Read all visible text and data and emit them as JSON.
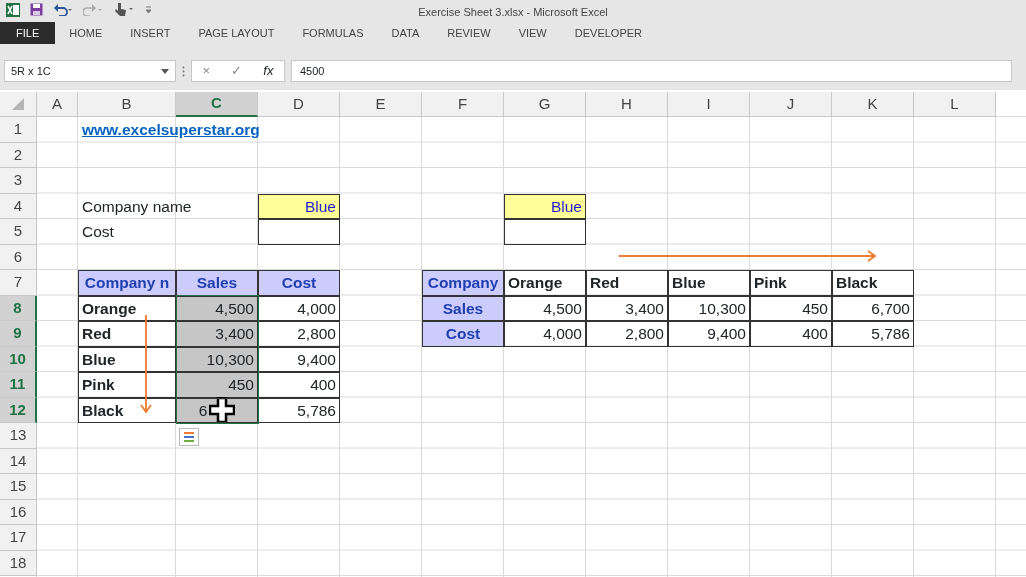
{
  "window": {
    "title": "Exercise Sheet 3.xlsx - Microsoft Excel"
  },
  "ribbon_tabs": [
    {
      "label": "FILE",
      "selected": true
    },
    {
      "label": "HOME",
      "selected": false
    },
    {
      "label": "INSERT",
      "selected": false
    },
    {
      "label": "PAGE LAYOUT",
      "selected": false
    },
    {
      "label": "FORMULAS",
      "selected": false
    },
    {
      "label": "DATA",
      "selected": false
    },
    {
      "label": "REVIEW",
      "selected": false
    },
    {
      "label": "VIEW",
      "selected": false
    },
    {
      "label": "DEVELOPER",
      "selected": false
    }
  ],
  "name_box": {
    "value": "5R x 1C"
  },
  "formula_bar": {
    "cancel": "×",
    "enter": "✓",
    "function": "fx",
    "value": "4500"
  },
  "columns": [
    {
      "letter": "A",
      "selected": false
    },
    {
      "letter": "B",
      "selected": false
    },
    {
      "letter": "C",
      "selected": true
    },
    {
      "letter": "D",
      "selected": false
    },
    {
      "letter": "E",
      "selected": false
    },
    {
      "letter": "F",
      "selected": false
    },
    {
      "letter": "G",
      "selected": false
    },
    {
      "letter": "H",
      "selected": false
    },
    {
      "letter": "I",
      "selected": false
    },
    {
      "letter": "J",
      "selected": false
    },
    {
      "letter": "K",
      "selected": false
    },
    {
      "letter": "L",
      "selected": false
    }
  ],
  "rows": [
    {
      "number": "1",
      "selected": false,
      "cells": {
        "B": {
          "kind": "link",
          "text": "www.excelsuperstar.org"
        }
      }
    },
    {
      "number": "2",
      "selected": false,
      "cells": {}
    },
    {
      "number": "3",
      "selected": false,
      "cells": {}
    },
    {
      "number": "4",
      "selected": false,
      "cells": {
        "B": {
          "kind": "text",
          "text": "Company name"
        },
        "D": {
          "kind": "input",
          "text": "Blue"
        },
        "G": {
          "kind": "input",
          "text": "Blue"
        }
      }
    },
    {
      "number": "5",
      "selected": false,
      "cells": {
        "B": {
          "kind": "text",
          "text": "Cost"
        },
        "D": {
          "kind": "box"
        },
        "G": {
          "kind": "box"
        }
      }
    },
    {
      "number": "6",
      "selected": false,
      "cells": {}
    },
    {
      "number": "7",
      "selected": false,
      "cells": {
        "B": {
          "kind": "header",
          "text": "Company n"
        },
        "C": {
          "kind": "header",
          "text": "Sales"
        },
        "D": {
          "kind": "header",
          "text": "Cost"
        },
        "F": {
          "kind": "header",
          "text": "Company"
        },
        "G": {
          "kind": "label",
          "text": "Orange"
        },
        "H": {
          "kind": "label",
          "text": "Red"
        },
        "I": {
          "kind": "label",
          "text": "Blue"
        },
        "J": {
          "kind": "label",
          "text": "Pink"
        },
        "K": {
          "kind": "label",
          "text": "Black"
        }
      }
    },
    {
      "number": "8",
      "selected": true,
      "cells": {
        "B": {
          "kind": "label",
          "text": "Orange"
        },
        "C": {
          "kind": "number",
          "text": "4,500",
          "selected": true
        },
        "D": {
          "kind": "number",
          "text": "4,000"
        },
        "F": {
          "kind": "header",
          "text": "Sales"
        },
        "G": {
          "kind": "number",
          "text": "4,500"
        },
        "H": {
          "kind": "number",
          "text": "3,400"
        },
        "I": {
          "kind": "number",
          "text": "10,300"
        },
        "J": {
          "kind": "number",
          "text": "450"
        },
        "K": {
          "kind": "number",
          "text": "6,700"
        }
      }
    },
    {
      "number": "9",
      "selected": true,
      "cells": {
        "B": {
          "kind": "label",
          "text": "Red"
        },
        "C": {
          "kind": "number",
          "text": "3,400",
          "selected": true
        },
        "D": {
          "kind": "number",
          "text": "2,800"
        },
        "F": {
          "kind": "header",
          "text": "Cost"
        },
        "G": {
          "kind": "number",
          "text": "4,000"
        },
        "H": {
          "kind": "number",
          "text": "2,800"
        },
        "I": {
          "kind": "number",
          "text": "9,400"
        },
        "J": {
          "kind": "number",
          "text": "400"
        },
        "K": {
          "kind": "number",
          "text": "5,786"
        }
      }
    },
    {
      "number": "10",
      "selected": true,
      "cells": {
        "B": {
          "kind": "label",
          "text": "Blue"
        },
        "C": {
          "kind": "number",
          "text": "10,300",
          "selected": true
        },
        "D": {
          "kind": "number",
          "text": "9,400"
        }
      }
    },
    {
      "number": "11",
      "selected": true,
      "cells": {
        "B": {
          "kind": "label",
          "text": "Pink"
        },
        "C": {
          "kind": "number",
          "text": "450",
          "selected": true
        },
        "D": {
          "kind": "number",
          "text": "400"
        }
      }
    },
    {
      "number": "12",
      "selected": true,
      "cells": {
        "B": {
          "kind": "label",
          "text": "Black"
        },
        "C": {
          "kind": "cursor",
          "text": "6",
          "selected": true
        },
        "D": {
          "kind": "number",
          "text": "5,786"
        }
      }
    },
    {
      "number": "13",
      "selected": false,
      "cells": {}
    },
    {
      "number": "14",
      "selected": false,
      "cells": {}
    },
    {
      "number": "15",
      "selected": false,
      "cells": {}
    },
    {
      "number": "16",
      "selected": false,
      "cells": {}
    },
    {
      "number": "17",
      "selected": false,
      "cells": {}
    },
    {
      "number": "18",
      "selected": false,
      "cells": {}
    }
  ]
}
